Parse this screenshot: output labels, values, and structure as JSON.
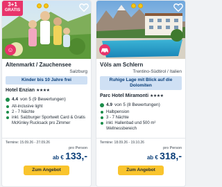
{
  "offers": [
    {
      "promo_big": "3+1",
      "promo_small": "GRATIS",
      "location_title": "Altenmarkt / Zauchensee",
      "location_region": "Salzburg",
      "highlight": "Kinder bis 10 Jahre frei",
      "hotel_name": "Hotel Enzian",
      "stars": "★★★★",
      "rating_value": "4.4",
      "rating_text": "von 5 (9 Bewertungen)",
      "features": [
        "All-inclusive light",
        "2 - 7 Nächte",
        "inkl. Salzburger Sportwelt Card & Gratis McKinley Rucksack pro Zimmer"
      ],
      "dates": "Termine: 15.09.26 - 27.09.26",
      "per_person": "pro Person",
      "price_prefix": "ab € ",
      "price_amount": "133,-",
      "cta_label": "Zum Angebot",
      "category_icon": "family-icon"
    },
    {
      "location_title": "Völs am Schlern",
      "location_region": "Trentino-Südtirol / Italien",
      "highlight": "Ruhige Lage mit Blick auf die Dolomiten",
      "hotel_name": "Parc Hotel Miramonti",
      "stars": "★★★★",
      "rating_value": "4.9",
      "rating_text": "von 5 (8 Bewertungen)",
      "features": [
        "Halbpension",
        "3 - 7 Nächte",
        "inkl. Hallenbad und 500 m² Wellnessbereich"
      ],
      "dates": "Termine: 18.09.26 - 19.10.26",
      "per_person": "pro Person",
      "price_prefix": "ab € ",
      "price_amount": "318,-",
      "cta_label": "Zum Angebot",
      "category_icon": "car-icon"
    }
  ],
  "colors": {
    "promo": "#e8346b",
    "highlight_bg": "#cfe0f4",
    "highlight_text": "#0b3f79",
    "price": "#0b3f79",
    "cta": "#f9c42d",
    "rating": "#1c8d4a"
  }
}
